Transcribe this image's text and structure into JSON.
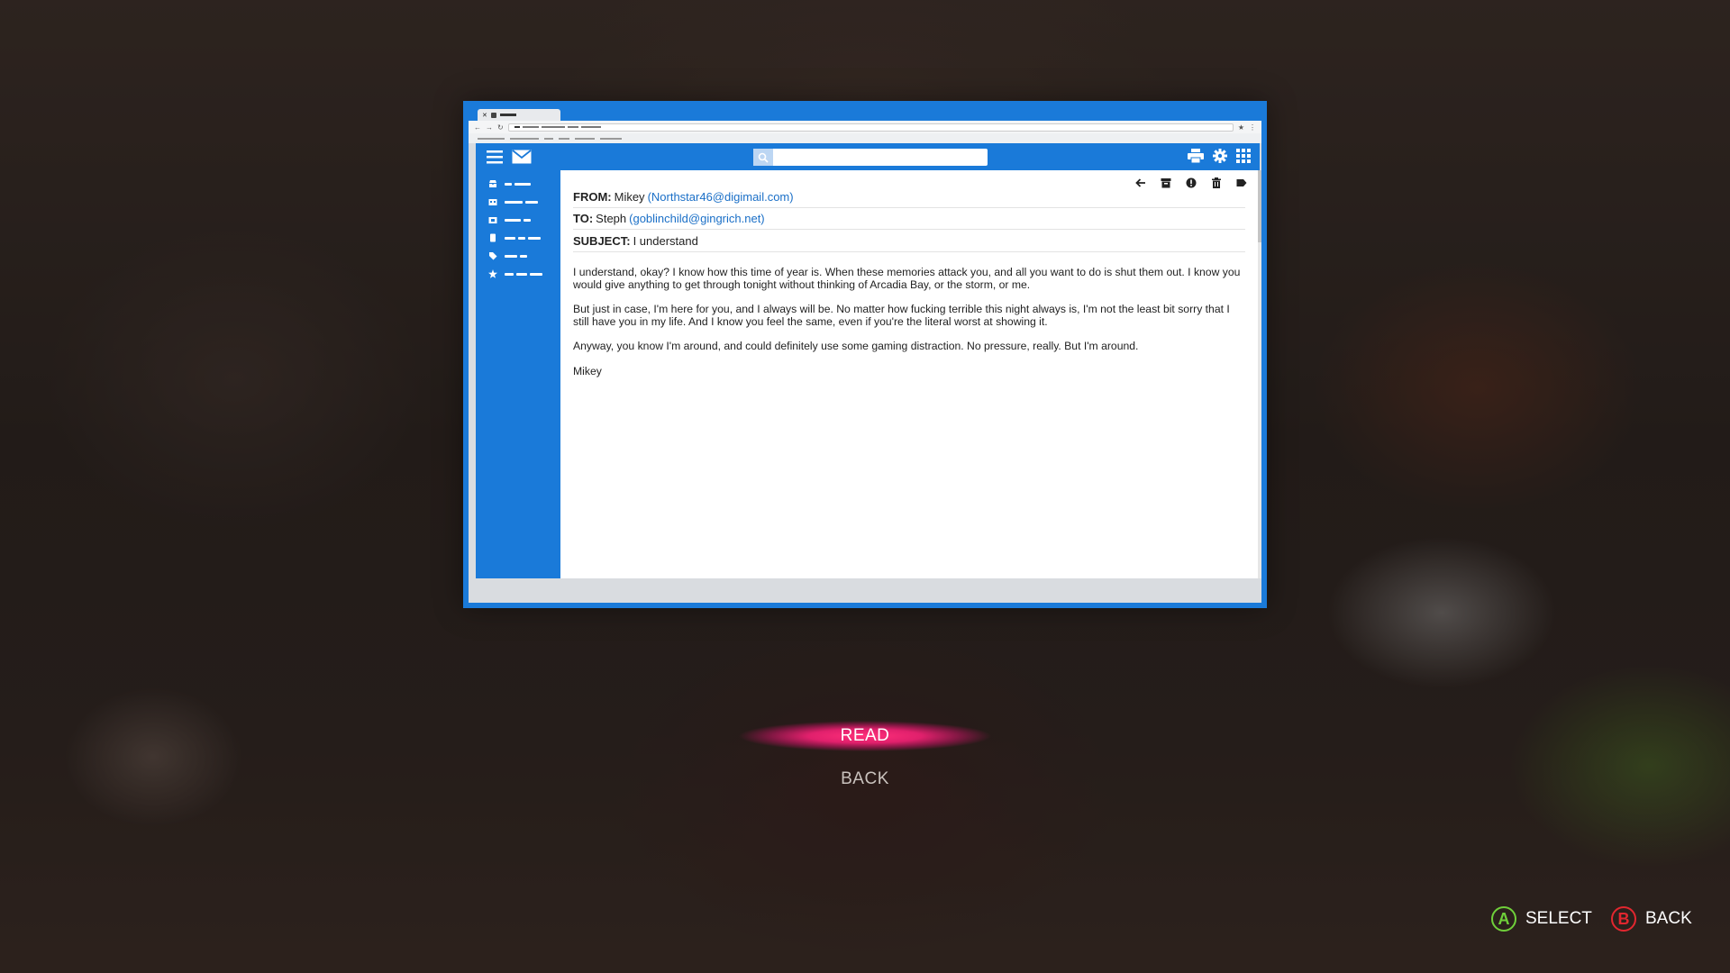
{
  "email": {
    "from_label": "FROM:",
    "from_name": "Mikey",
    "from_address": "(Northstar46@digimail.com)",
    "to_label": "TO:",
    "to_name": "Steph",
    "to_address": "(goblinchild@gingrich.net)",
    "subject_label": "SUBJECT:",
    "subject": "I understand",
    "body": [
      "I understand, okay? I know how this time of year is. When these memories attack you, and all you want to do is shut them out. I know you would give anything to get through tonight without thinking of Arcadia Bay, or the storm, or me.",
      "But just in case, I'm here for you, and I always will be. No matter how fucking terrible this night always is, I'm not the least bit sorry that I still have you in my life. And I know you feel the same, even if you're the literal worst at showing it.",
      "Anyway, you know I'm around, and could definitely use some gaming distraction. No pressure, really. But I'm around.",
      "Mikey"
    ]
  },
  "menu": {
    "read_label": "READ",
    "back_label": "BACK"
  },
  "prompts": {
    "select_button": "A",
    "select_label": "SELECT",
    "back_button": "B",
    "back_label": "BACK"
  },
  "colors": {
    "accent_blue": "#1a7ad9",
    "link_blue": "#1a6fc7",
    "highlight_pink": "#e0206c",
    "button_a_green": "#6fcf3a",
    "button_b_red": "#e2262f"
  },
  "icons": {
    "header": [
      "menu-icon",
      "mail-icon",
      "search-icon",
      "print-icon",
      "settings-icon",
      "apps-grid-icon"
    ],
    "toolbar": [
      "back-arrow-icon",
      "archive-icon",
      "report-icon",
      "trash-icon",
      "label-icon"
    ],
    "sidebar": [
      "inbox-icon",
      "drafts-icon",
      "sent-icon",
      "documents-icon",
      "tag-icon",
      "star-icon"
    ]
  }
}
